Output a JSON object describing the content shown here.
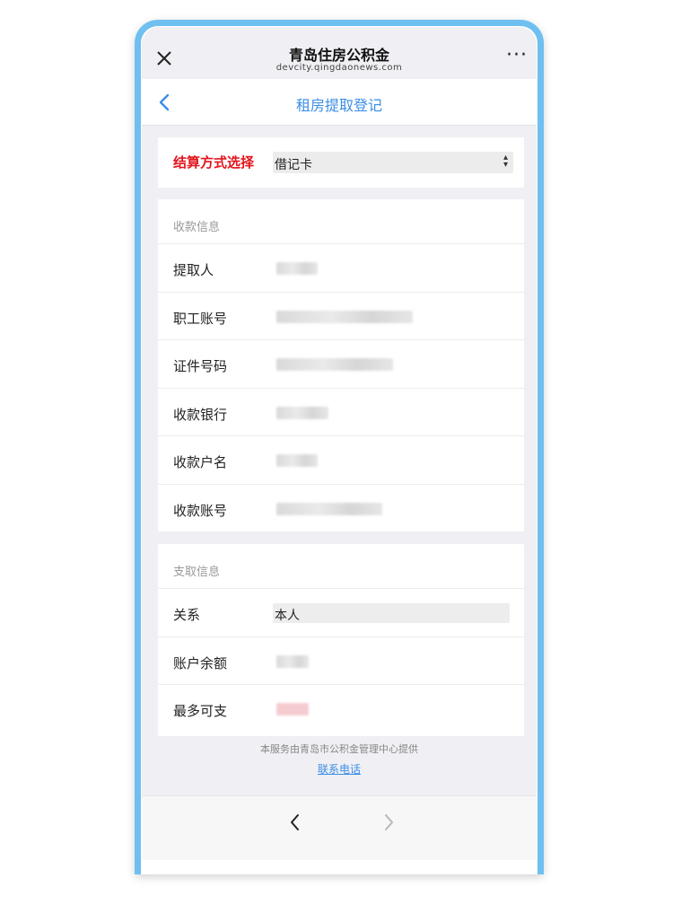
{
  "wechat": {
    "title": "青岛住房公积金",
    "url": "devcity.qingdaonews.com",
    "more": "···"
  },
  "header": {
    "title": "租房提取登记"
  },
  "settlement": {
    "label": "结算方式选择",
    "value": "借记卡",
    "label_color": "#e3141c"
  },
  "payee_section": {
    "title": "收款信息",
    "rows": [
      {
        "label": "提取人"
      },
      {
        "label": "职工账号"
      },
      {
        "label": "证件号码"
      },
      {
        "label": "收款银行"
      },
      {
        "label": "收款户名"
      },
      {
        "label": "收款账号"
      }
    ]
  },
  "withdraw_section": {
    "title": "支取信息",
    "relation_label": "关系",
    "relation_value": "本人",
    "balance_label": "账户余额",
    "max_label": "最多可支"
  },
  "footer": {
    "note": "本服务由青岛市公积金管理中心提供",
    "contact_link": "联系电话"
  },
  "colors": {
    "accent": "#3a8ee6",
    "frame": "#6fbff0"
  }
}
